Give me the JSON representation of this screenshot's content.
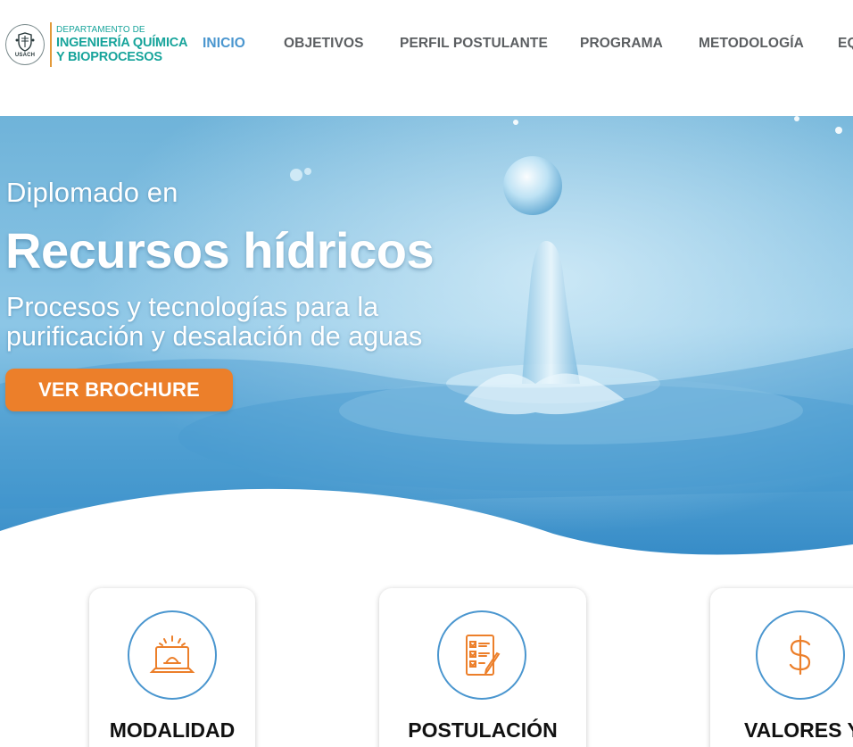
{
  "logo": {
    "seal_text": "USACH",
    "line1": "DEPARTAMENTO DE",
    "line2": "INGENIERÍA QUÍMICA",
    "line3": "Y BIOPROCESOS"
  },
  "nav": {
    "items": [
      {
        "label": "INICIO",
        "active": true
      },
      {
        "label": "OBJETIVOS"
      },
      {
        "label": "PERFIL POSTULANTE"
      },
      {
        "label": "PROGRAMA"
      },
      {
        "label": "METODOLOGÍA"
      },
      {
        "label": "EQ"
      }
    ]
  },
  "hero": {
    "pre_title": "Diplomado en",
    "title": "Recursos hídricos",
    "subtitle": "Procesos y tecnologías para la purificación y desalación de aguas",
    "button_label": "VER BROCHURE"
  },
  "cards": [
    {
      "title": "MODALIDAD",
      "icon": "laptop-icon"
    },
    {
      "title": "POSTULACIÓN",
      "icon": "checklist-icon"
    },
    {
      "title": "VALORES Y",
      "icon": "dollar-icon"
    }
  ],
  "colors": {
    "accent_blue": "#4a96cf",
    "orange": "#ec7f2a",
    "logo_teal": "#17a49b",
    "nav_text": "#5b5e61"
  }
}
